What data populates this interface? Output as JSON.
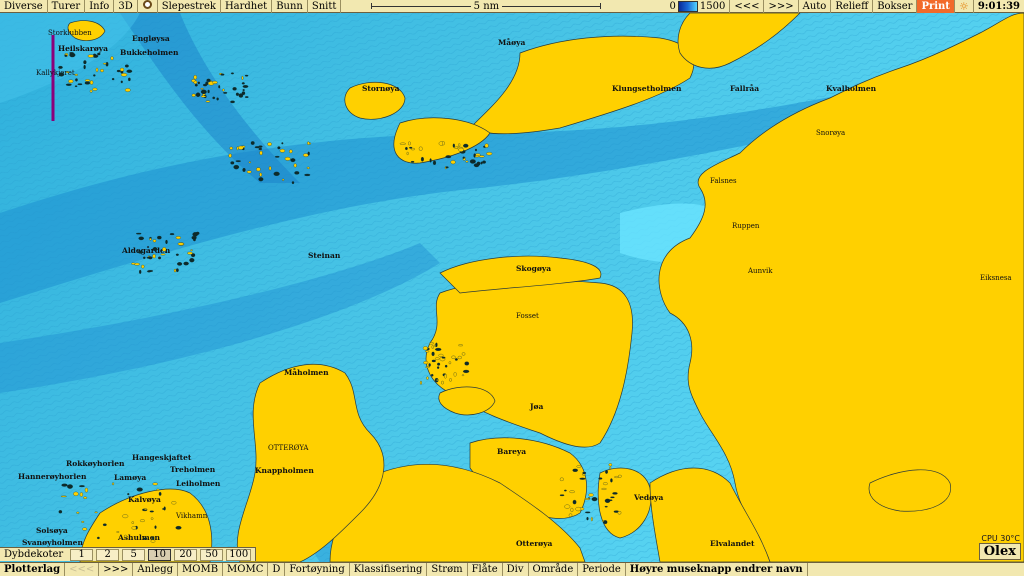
{
  "colors": {
    "land": "#ffd000",
    "sea_shallow": "#68e4ff",
    "sea_mid": "#3cbde0",
    "sea_deep": "#1d8fd0",
    "toolbar": "#f2e8b0",
    "print_button": "#f26a2a",
    "track_line": "#8b007a"
  },
  "topbar": {
    "menu": [
      "Diverse",
      "Turer",
      "Info",
      "3D"
    ],
    "tools": [
      "Slepestrek",
      "Hardhet",
      "Bunn",
      "Snitt"
    ],
    "scale_label": "5 nm",
    "depth_min": "0",
    "depth_max": "1500",
    "prev": "<<<",
    "next": ">>>",
    "right_buttons": [
      "Auto",
      "Relieff",
      "Bokser"
    ],
    "print": "Print",
    "clock": "9:01:39",
    "icons": [
      "target-icon",
      "sun-icon"
    ]
  },
  "depthbar": {
    "title": "Dybdekoter",
    "options": [
      "1",
      "2",
      "5",
      "10",
      "20",
      "50",
      "100"
    ],
    "selected": "10"
  },
  "bottombar": {
    "layers": "Plotterlag",
    "prev": "<<<",
    "next": ">>>",
    "buttons": [
      "Anlegg",
      "MOMB",
      "MOMC",
      "D",
      "Fortøyning",
      "Klassifisering",
      "Strøm",
      "Flåte",
      "Div",
      "Område",
      "Periode"
    ],
    "hint": "Høyre museknapp endrer navn"
  },
  "brand": "Olex",
  "cpu": "CPU 30°C",
  "map_labels": [
    {
      "text": "Storklubben",
      "big": false
    },
    {
      "text": "Engløysa",
      "big": true
    },
    {
      "text": "Bukkeholmen",
      "big": true
    },
    {
      "text": "Heilskarøya",
      "big": true
    },
    {
      "text": "Kallykjeret",
      "big": false
    },
    {
      "text": "Måøya",
      "big": true
    },
    {
      "text": "Stornøya",
      "big": true
    },
    {
      "text": "Klungsetholmen",
      "big": true
    },
    {
      "text": "Fallråa",
      "big": true
    },
    {
      "text": "Kvalholmen",
      "big": true
    },
    {
      "text": "Steinan",
      "big": true
    },
    {
      "text": "Aldegården",
      "big": true
    },
    {
      "text": "Skogøya",
      "big": true
    },
    {
      "text": "Falsnes",
      "big": false
    },
    {
      "text": "Ruppen",
      "big": false
    },
    {
      "text": "Fosset",
      "big": false
    },
    {
      "text": "Måholmen",
      "big": true
    },
    {
      "text": "OTTERØYA",
      "big": false
    },
    {
      "text": "Knappholmen",
      "big": true
    },
    {
      "text": "Bareya",
      "big": true
    },
    {
      "text": "Jøa",
      "big": true
    },
    {
      "text": "Vedøya",
      "big": true
    },
    {
      "text": "Otterøya",
      "big": true
    },
    {
      "text": "Elvalandet",
      "big": true
    },
    {
      "text": "Rokkøyhorlen",
      "big": true
    },
    {
      "text": "Hannerøyhorlen",
      "big": true
    },
    {
      "text": "Lamøya",
      "big": true
    },
    {
      "text": "Hangeskjaftet",
      "big": true
    },
    {
      "text": "Treholmen",
      "big": true
    },
    {
      "text": "Leiholmen",
      "big": true
    },
    {
      "text": "Kalvøya",
      "big": true
    },
    {
      "text": "Solsøya",
      "big": true
    },
    {
      "text": "Svanøyholmen",
      "big": true
    },
    {
      "text": "Ashulmen",
      "big": true
    },
    {
      "text": "Vikhamn",
      "big": false
    },
    {
      "text": "Eiksnesa",
      "big": false
    },
    {
      "text": "Aunvik",
      "big": false
    },
    {
      "text": "Snorøya",
      "big": false
    }
  ]
}
